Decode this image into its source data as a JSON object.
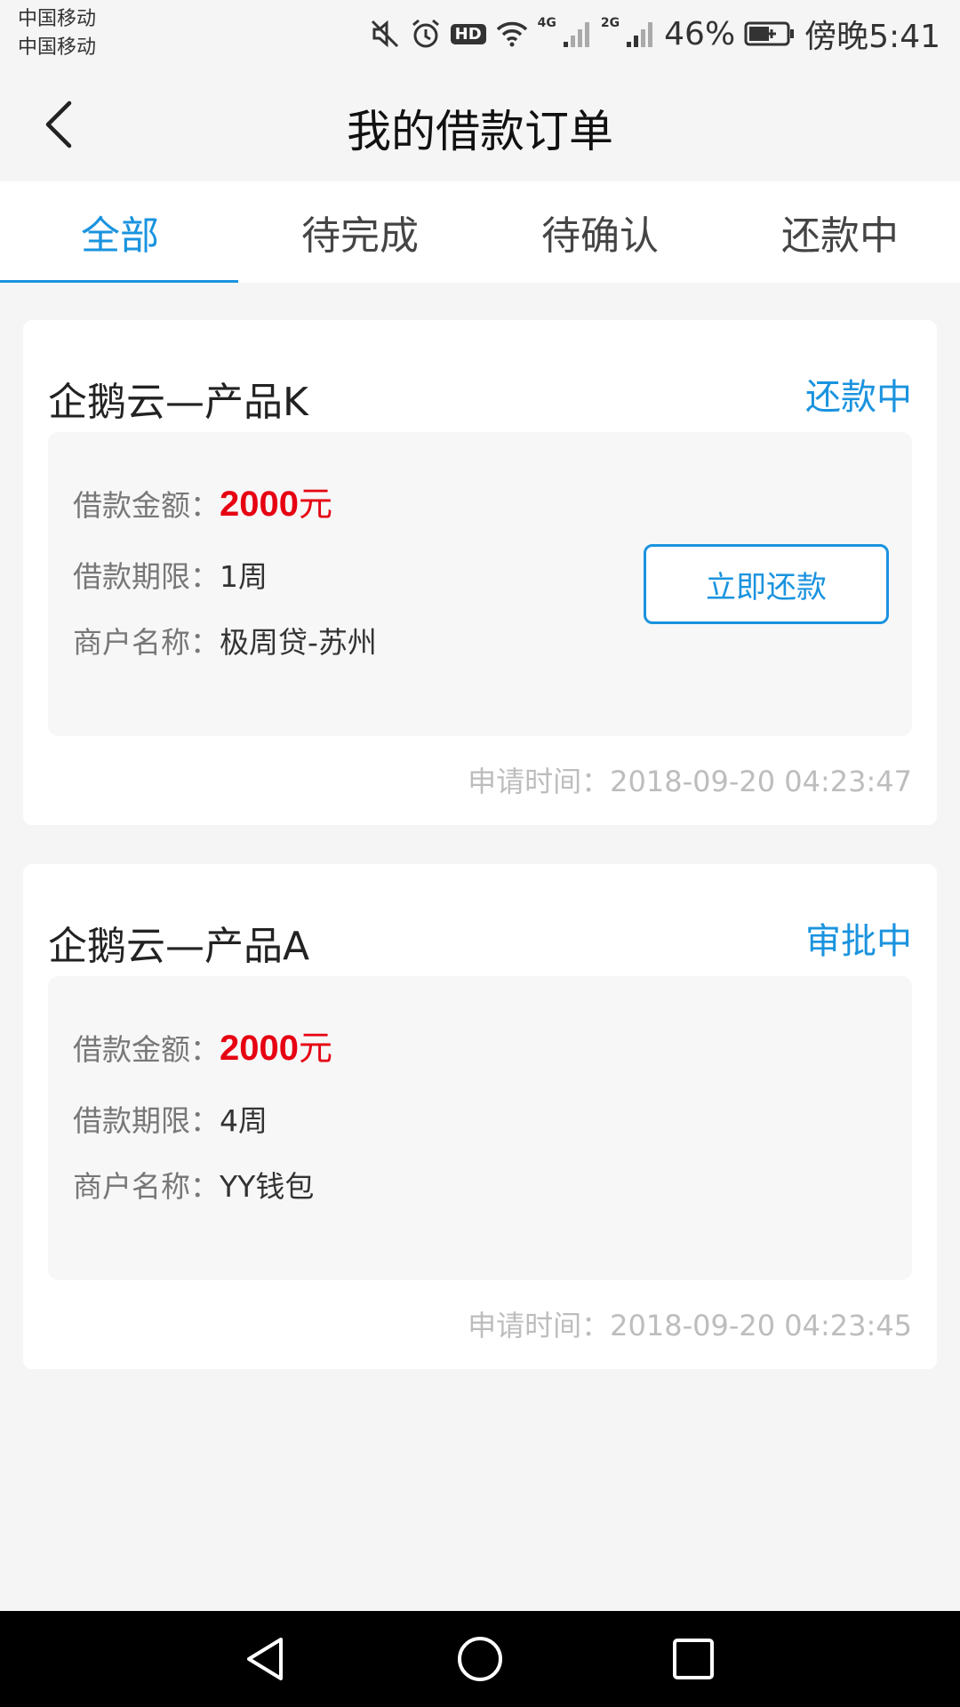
{
  "status_bar": {
    "carrier_1": "中国移动",
    "carrier_2": "中国移动",
    "hd_badge": "HD",
    "net_1": "4G",
    "net_2": "2G",
    "battery_percent": "46%",
    "time": "傍晚5:41",
    "icons": [
      "mute-icon",
      "alarm-icon",
      "wifi-icon",
      "signal-icon",
      "battery-icon"
    ]
  },
  "header": {
    "title": "我的借款订单",
    "back_icon": "chevron-left-icon"
  },
  "tabs": [
    {
      "label": "全部",
      "active": true
    },
    {
      "label": "待完成",
      "active": false
    },
    {
      "label": "待确认",
      "active": false
    },
    {
      "label": "还款中",
      "active": false
    }
  ],
  "orders": [
    {
      "title": "企鹅云—产品K",
      "status": "还款中",
      "amount_label": "借款金额：",
      "amount_value": "2000",
      "amount_unit": "元",
      "term_label": "借款期限：",
      "term_value": "1周",
      "merchant_label": "商户名称：",
      "merchant_value": "极周贷-苏州",
      "action_label": "立即还款",
      "apply_time_label": "申请时间：",
      "apply_time_value": "2018-09-20 04:23:47"
    },
    {
      "title": "企鹅云—产品A",
      "status": "审批中",
      "amount_label": "借款金额：",
      "amount_value": "2000",
      "amount_unit": "元",
      "term_label": "借款期限：",
      "term_value": "4周",
      "merchant_label": "商户名称：",
      "merchant_value": "YY钱包",
      "apply_time_label": "申请时间：",
      "apply_time_value": "2018-09-20 04:23:45"
    }
  ],
  "colors": {
    "accent": "#1a93df",
    "amount": "#e60012",
    "background": "#f5f5f5"
  },
  "nav_bar": {
    "icons": [
      "nav-back-icon",
      "nav-home-icon",
      "nav-recents-icon"
    ]
  }
}
